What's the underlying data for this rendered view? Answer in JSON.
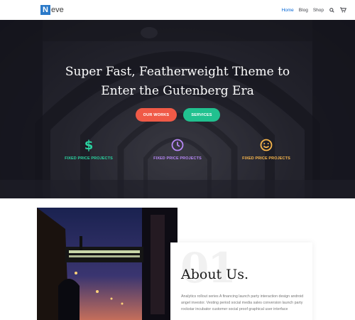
{
  "header": {
    "logo_letter": "N",
    "logo_text": "eve",
    "nav": [
      "Home",
      "Blog",
      "Shop"
    ],
    "accent": "#0366d6",
    "icons": [
      "search-icon",
      "cart-icon"
    ]
  },
  "hero": {
    "title_line1": "Super Fast, Featherweight Theme to",
    "title_line2": "Enter the Gutenberg Era",
    "buttons": [
      {
        "label": "OUR WORKS",
        "color": "#f05a47"
      },
      {
        "label": "SERVICES",
        "color": "#21c18f"
      }
    ],
    "features": [
      {
        "icon": "dollar-icon",
        "label": "FIXED PRICE PROJECTS",
        "color": "#2bd3a0"
      },
      {
        "icon": "clock-icon",
        "label": "FIXED PRICE PROJECTS",
        "color": "#b687f5"
      },
      {
        "icon": "smiley-icon",
        "label": "FIXED PRICE PROJECTS",
        "color": "#f8b64c"
      }
    ]
  },
  "about": {
    "number": "01",
    "title": "About Us.",
    "text": "Analytics rollout series A financing launch party interaction design android angel investor. Vesting period social media sales conversion launch party rockstar incubator customer social proof graphical user interface"
  }
}
